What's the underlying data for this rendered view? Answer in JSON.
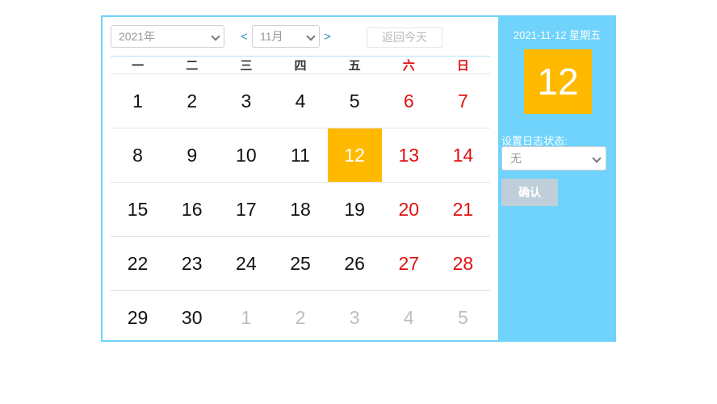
{
  "toolbar": {
    "year_value": "2021年",
    "prev_label": "<",
    "month_value": "11月",
    "next_label": ">",
    "today_label": "返回今天"
  },
  "weekdays": [
    "一",
    "二",
    "三",
    "四",
    "五",
    "六",
    "日"
  ],
  "weeks": [
    [
      {
        "d": "1"
      },
      {
        "d": "2"
      },
      {
        "d": "3"
      },
      {
        "d": "4"
      },
      {
        "d": "5"
      },
      {
        "d": "6"
      },
      {
        "d": "7"
      }
    ],
    [
      {
        "d": "8"
      },
      {
        "d": "9"
      },
      {
        "d": "10"
      },
      {
        "d": "11"
      },
      {
        "d": "12",
        "selected": true
      },
      {
        "d": "13"
      },
      {
        "d": "14"
      }
    ],
    [
      {
        "d": "15"
      },
      {
        "d": "16"
      },
      {
        "d": "17"
      },
      {
        "d": "18"
      },
      {
        "d": "19"
      },
      {
        "d": "20"
      },
      {
        "d": "21"
      }
    ],
    [
      {
        "d": "22"
      },
      {
        "d": "23"
      },
      {
        "d": "24"
      },
      {
        "d": "25"
      },
      {
        "d": "26"
      },
      {
        "d": "27"
      },
      {
        "d": "28"
      }
    ],
    [
      {
        "d": "29"
      },
      {
        "d": "30"
      },
      {
        "d": "1",
        "other": true
      },
      {
        "d": "2",
        "other": true
      },
      {
        "d": "3",
        "other": true
      },
      {
        "d": "4",
        "other": true
      },
      {
        "d": "5",
        "other": true
      }
    ]
  ],
  "side": {
    "date_text": "2021-11-12 星期五",
    "big_day": "12",
    "status_label": "设置日志状态:",
    "status_value": "无",
    "confirm_label": "确认"
  },
  "colors": {
    "accent": "#6fd3fb",
    "selected": "#ffba00",
    "weekend": "#e01010",
    "muted": "#bdbdbd"
  }
}
